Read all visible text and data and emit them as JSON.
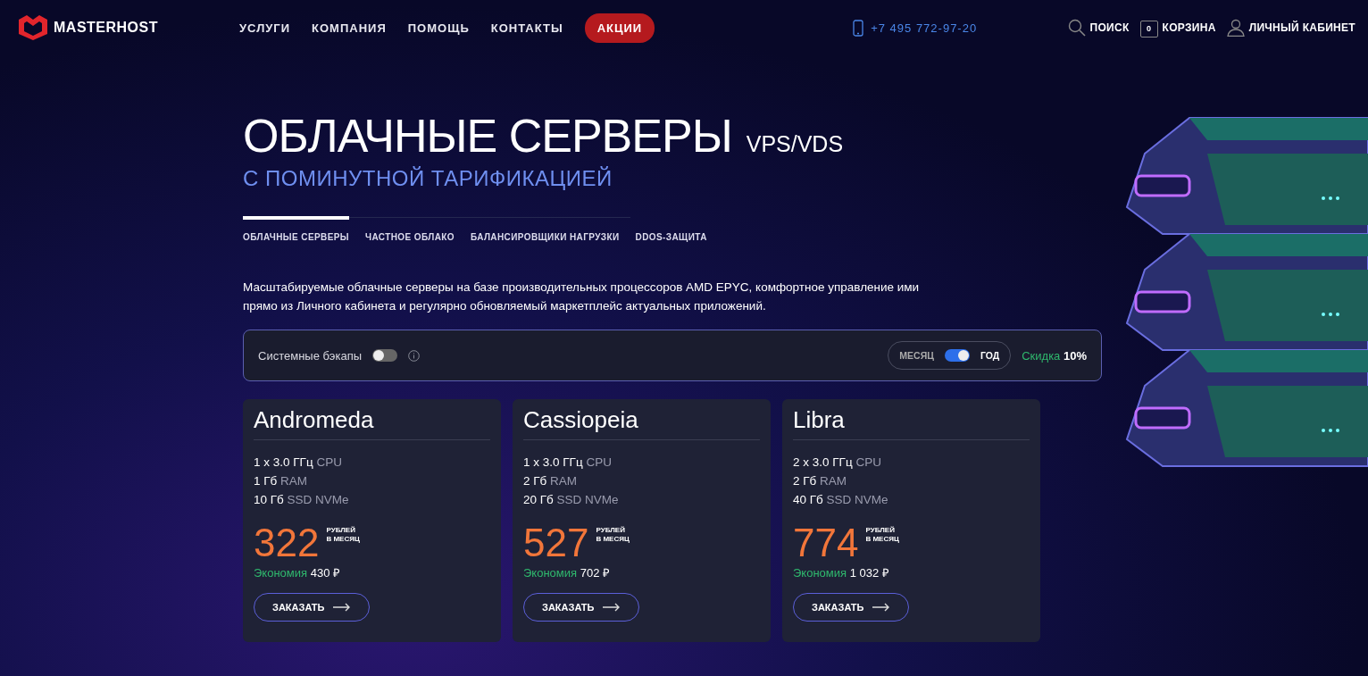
{
  "header": {
    "logo": "MASTERHOST",
    "nav": [
      {
        "label": "УСЛУГИ",
        "kind": "link"
      },
      {
        "label": "КОМПАНИЯ",
        "kind": "link"
      },
      {
        "label": "ПОМОЩЬ",
        "kind": "link"
      },
      {
        "label": "КОНТАКТЫ",
        "kind": "link"
      },
      {
        "label": "АКЦИИ",
        "kind": "pill"
      }
    ],
    "phone": "+7 495 772-97-20",
    "cart_count": "0",
    "actions": [
      {
        "label": "ПОИСК",
        "kind": "search"
      },
      {
        "label": "КОРЗИНА",
        "kind": "cart"
      },
      {
        "label": "ЛИЧНЫЙ КАБИНЕТ",
        "kind": "user"
      }
    ]
  },
  "hero": {
    "title": "ОБЛАЧНЫЕ СЕРВЕРЫ",
    "title_suffix": "VPS/VDS",
    "subtitle": "С ПОМИНУТНОЙ ТАРИФИКАЦИЕЙ"
  },
  "tabs": [
    {
      "label": "ОБЛАЧНЫЕ СЕРВЕРЫ",
      "selected": true
    },
    {
      "label": "ЧАСТНОЕ ОБЛАКО",
      "selected": false
    },
    {
      "label": "БАЛАНСИРОВЩИКИ НАГРУЗКИ",
      "selected": false
    },
    {
      "label": "DDOS-ЗАЩИТА",
      "selected": false
    }
  ],
  "description": "Масштабируемые облачные серверы на базе производительных процессоров AMD EPYC, комфортное управление ими прямо из Личного кабинета и регулярно обновляемый маркетплейс актуальных приложений.",
  "options": {
    "backups": {
      "label": "Системные бэкапы",
      "on": false
    },
    "period": {
      "left": "МЕСЯЦ",
      "right": "ГОД",
      "on": true
    },
    "discount_label": "Скидка",
    "discount_value": "10%"
  },
  "plans": [
    {
      "name": "Andromeda",
      "specs": [
        {
          "value": "1 x 3.0 ГГц",
          "unit": "CPU"
        },
        {
          "value": "1 Гб",
          "unit": "RAM"
        },
        {
          "value": "10 Гб",
          "unit": "SSD NVMe"
        }
      ],
      "price": "322",
      "price_unit": [
        "РУБЛЕЙ",
        "В МЕСЯЦ"
      ],
      "saving_label": "Экономия",
      "saving": "430 ₽",
      "button": "ЗАКАЗАТЬ"
    },
    {
      "name": "Cassiopeia",
      "specs": [
        {
          "value": "1 x 3.0 ГГц",
          "unit": "CPU"
        },
        {
          "value": "2 Гб",
          "unit": "RAM"
        },
        {
          "value": "20 Гб",
          "unit": "SSD NVMe"
        }
      ],
      "price": "527",
      "price_unit": [
        "РУБЛЕЙ",
        "В МЕСЯЦ"
      ],
      "saving_label": "Экономия",
      "saving": "702 ₽",
      "button": "ЗАКАЗАТЬ"
    },
    {
      "name": "Libra",
      "specs": [
        {
          "value": "2 x 3.0 ГГц",
          "unit": "CPU"
        },
        {
          "value": "2 Гб",
          "unit": "RAM"
        },
        {
          "value": "40 Гб",
          "unit": "SSD NVMe"
        }
      ],
      "price": "774",
      "price_unit": [
        "РУБЛЕЙ",
        "В МЕСЯЦ"
      ],
      "saving_label": "Экономия",
      "saving": "1 032 ₽",
      "button": "ЗАКАЗАТЬ"
    }
  ]
}
